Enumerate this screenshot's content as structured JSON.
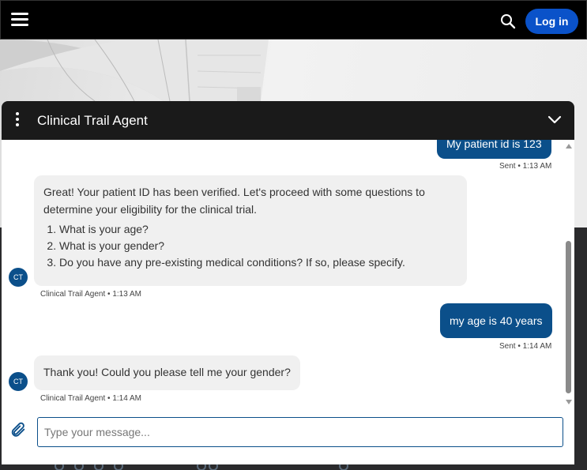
{
  "topbar": {
    "login_label": "Log in"
  },
  "chat": {
    "title": "Clinical Trail Agent",
    "avatar_initials": "CT",
    "messages": [
      {
        "from": "user",
        "text": "My patient id is 123",
        "meta": "Sent • 1:13 AM"
      },
      {
        "from": "agent",
        "intro": "Great! Your patient ID has been verified. Let's proceed with some questions to determine your eligibility for the clinical trial.",
        "items": [
          "What is your age?",
          "What is your gender?",
          "Do you have any pre-existing medical conditions? If so, please specify."
        ],
        "meta": "Clinical Trail Agent • 1:13 AM"
      },
      {
        "from": "user",
        "text": "my age is 40 years",
        "meta": "Sent • 1:14 AM"
      },
      {
        "from": "agent",
        "text": "Thank you! Could you please tell me your gender?",
        "meta": "Clinical Trail Agent • 1:14 AM"
      }
    ],
    "input_placeholder": "Type your message...",
    "input_value": ""
  },
  "icons": {
    "menu": "hamburger-icon",
    "search": "search-icon",
    "options": "kebab-icon",
    "collapse": "chevron-down-icon",
    "attach": "paperclip-icon"
  },
  "colors": {
    "accent": "#0b4f8a",
    "login": "#0a52c9",
    "header": "#1a1a1a"
  }
}
